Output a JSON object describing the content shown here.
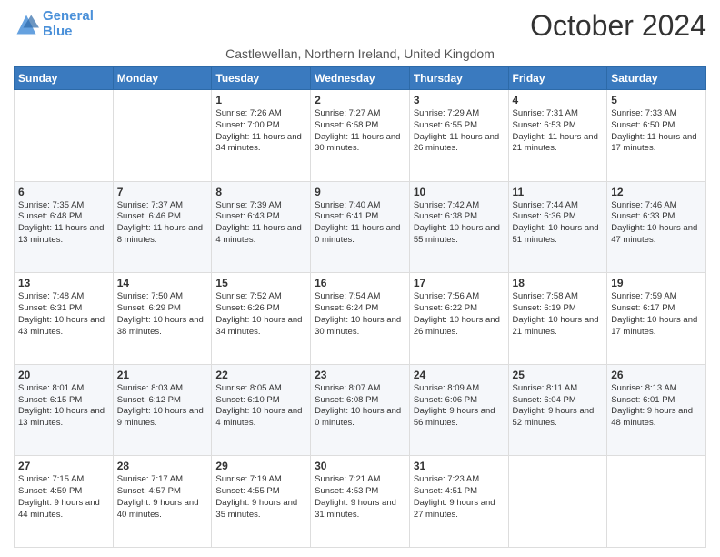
{
  "logo": {
    "line1": "General",
    "line2": "Blue"
  },
  "title": "October 2024",
  "subtitle": "Castlewellan, Northern Ireland, United Kingdom",
  "days_of_week": [
    "Sunday",
    "Monday",
    "Tuesday",
    "Wednesday",
    "Thursday",
    "Friday",
    "Saturday"
  ],
  "weeks": [
    [
      {
        "day": "",
        "sunrise": "",
        "sunset": "",
        "daylight": ""
      },
      {
        "day": "",
        "sunrise": "",
        "sunset": "",
        "daylight": ""
      },
      {
        "day": "1",
        "sunrise": "Sunrise: 7:26 AM",
        "sunset": "Sunset: 7:00 PM",
        "daylight": "Daylight: 11 hours and 34 minutes."
      },
      {
        "day": "2",
        "sunrise": "Sunrise: 7:27 AM",
        "sunset": "Sunset: 6:58 PM",
        "daylight": "Daylight: 11 hours and 30 minutes."
      },
      {
        "day": "3",
        "sunrise": "Sunrise: 7:29 AM",
        "sunset": "Sunset: 6:55 PM",
        "daylight": "Daylight: 11 hours and 26 minutes."
      },
      {
        "day": "4",
        "sunrise": "Sunrise: 7:31 AM",
        "sunset": "Sunset: 6:53 PM",
        "daylight": "Daylight: 11 hours and 21 minutes."
      },
      {
        "day": "5",
        "sunrise": "Sunrise: 7:33 AM",
        "sunset": "Sunset: 6:50 PM",
        "daylight": "Daylight: 11 hours and 17 minutes."
      }
    ],
    [
      {
        "day": "6",
        "sunrise": "Sunrise: 7:35 AM",
        "sunset": "Sunset: 6:48 PM",
        "daylight": "Daylight: 11 hours and 13 minutes."
      },
      {
        "day": "7",
        "sunrise": "Sunrise: 7:37 AM",
        "sunset": "Sunset: 6:46 PM",
        "daylight": "Daylight: 11 hours and 8 minutes."
      },
      {
        "day": "8",
        "sunrise": "Sunrise: 7:39 AM",
        "sunset": "Sunset: 6:43 PM",
        "daylight": "Daylight: 11 hours and 4 minutes."
      },
      {
        "day": "9",
        "sunrise": "Sunrise: 7:40 AM",
        "sunset": "Sunset: 6:41 PM",
        "daylight": "Daylight: 11 hours and 0 minutes."
      },
      {
        "day": "10",
        "sunrise": "Sunrise: 7:42 AM",
        "sunset": "Sunset: 6:38 PM",
        "daylight": "Daylight: 10 hours and 55 minutes."
      },
      {
        "day": "11",
        "sunrise": "Sunrise: 7:44 AM",
        "sunset": "Sunset: 6:36 PM",
        "daylight": "Daylight: 10 hours and 51 minutes."
      },
      {
        "day": "12",
        "sunrise": "Sunrise: 7:46 AM",
        "sunset": "Sunset: 6:33 PM",
        "daylight": "Daylight: 10 hours and 47 minutes."
      }
    ],
    [
      {
        "day": "13",
        "sunrise": "Sunrise: 7:48 AM",
        "sunset": "Sunset: 6:31 PM",
        "daylight": "Daylight: 10 hours and 43 minutes."
      },
      {
        "day": "14",
        "sunrise": "Sunrise: 7:50 AM",
        "sunset": "Sunset: 6:29 PM",
        "daylight": "Daylight: 10 hours and 38 minutes."
      },
      {
        "day": "15",
        "sunrise": "Sunrise: 7:52 AM",
        "sunset": "Sunset: 6:26 PM",
        "daylight": "Daylight: 10 hours and 34 minutes."
      },
      {
        "day": "16",
        "sunrise": "Sunrise: 7:54 AM",
        "sunset": "Sunset: 6:24 PM",
        "daylight": "Daylight: 10 hours and 30 minutes."
      },
      {
        "day": "17",
        "sunrise": "Sunrise: 7:56 AM",
        "sunset": "Sunset: 6:22 PM",
        "daylight": "Daylight: 10 hours and 26 minutes."
      },
      {
        "day": "18",
        "sunrise": "Sunrise: 7:58 AM",
        "sunset": "Sunset: 6:19 PM",
        "daylight": "Daylight: 10 hours and 21 minutes."
      },
      {
        "day": "19",
        "sunrise": "Sunrise: 7:59 AM",
        "sunset": "Sunset: 6:17 PM",
        "daylight": "Daylight: 10 hours and 17 minutes."
      }
    ],
    [
      {
        "day": "20",
        "sunrise": "Sunrise: 8:01 AM",
        "sunset": "Sunset: 6:15 PM",
        "daylight": "Daylight: 10 hours and 13 minutes."
      },
      {
        "day": "21",
        "sunrise": "Sunrise: 8:03 AM",
        "sunset": "Sunset: 6:12 PM",
        "daylight": "Daylight: 10 hours and 9 minutes."
      },
      {
        "day": "22",
        "sunrise": "Sunrise: 8:05 AM",
        "sunset": "Sunset: 6:10 PM",
        "daylight": "Daylight: 10 hours and 4 minutes."
      },
      {
        "day": "23",
        "sunrise": "Sunrise: 8:07 AM",
        "sunset": "Sunset: 6:08 PM",
        "daylight": "Daylight: 10 hours and 0 minutes."
      },
      {
        "day": "24",
        "sunrise": "Sunrise: 8:09 AM",
        "sunset": "Sunset: 6:06 PM",
        "daylight": "Daylight: 9 hours and 56 minutes."
      },
      {
        "day": "25",
        "sunrise": "Sunrise: 8:11 AM",
        "sunset": "Sunset: 6:04 PM",
        "daylight": "Daylight: 9 hours and 52 minutes."
      },
      {
        "day": "26",
        "sunrise": "Sunrise: 8:13 AM",
        "sunset": "Sunset: 6:01 PM",
        "daylight": "Daylight: 9 hours and 48 minutes."
      }
    ],
    [
      {
        "day": "27",
        "sunrise": "Sunrise: 7:15 AM",
        "sunset": "Sunset: 4:59 PM",
        "daylight": "Daylight: 9 hours and 44 minutes."
      },
      {
        "day": "28",
        "sunrise": "Sunrise: 7:17 AM",
        "sunset": "Sunset: 4:57 PM",
        "daylight": "Daylight: 9 hours and 40 minutes."
      },
      {
        "day": "29",
        "sunrise": "Sunrise: 7:19 AM",
        "sunset": "Sunset: 4:55 PM",
        "daylight": "Daylight: 9 hours and 35 minutes."
      },
      {
        "day": "30",
        "sunrise": "Sunrise: 7:21 AM",
        "sunset": "Sunset: 4:53 PM",
        "daylight": "Daylight: 9 hours and 31 minutes."
      },
      {
        "day": "31",
        "sunrise": "Sunrise: 7:23 AM",
        "sunset": "Sunset: 4:51 PM",
        "daylight": "Daylight: 9 hours and 27 minutes."
      },
      {
        "day": "",
        "sunrise": "",
        "sunset": "",
        "daylight": ""
      },
      {
        "day": "",
        "sunrise": "",
        "sunset": "",
        "daylight": ""
      }
    ]
  ]
}
